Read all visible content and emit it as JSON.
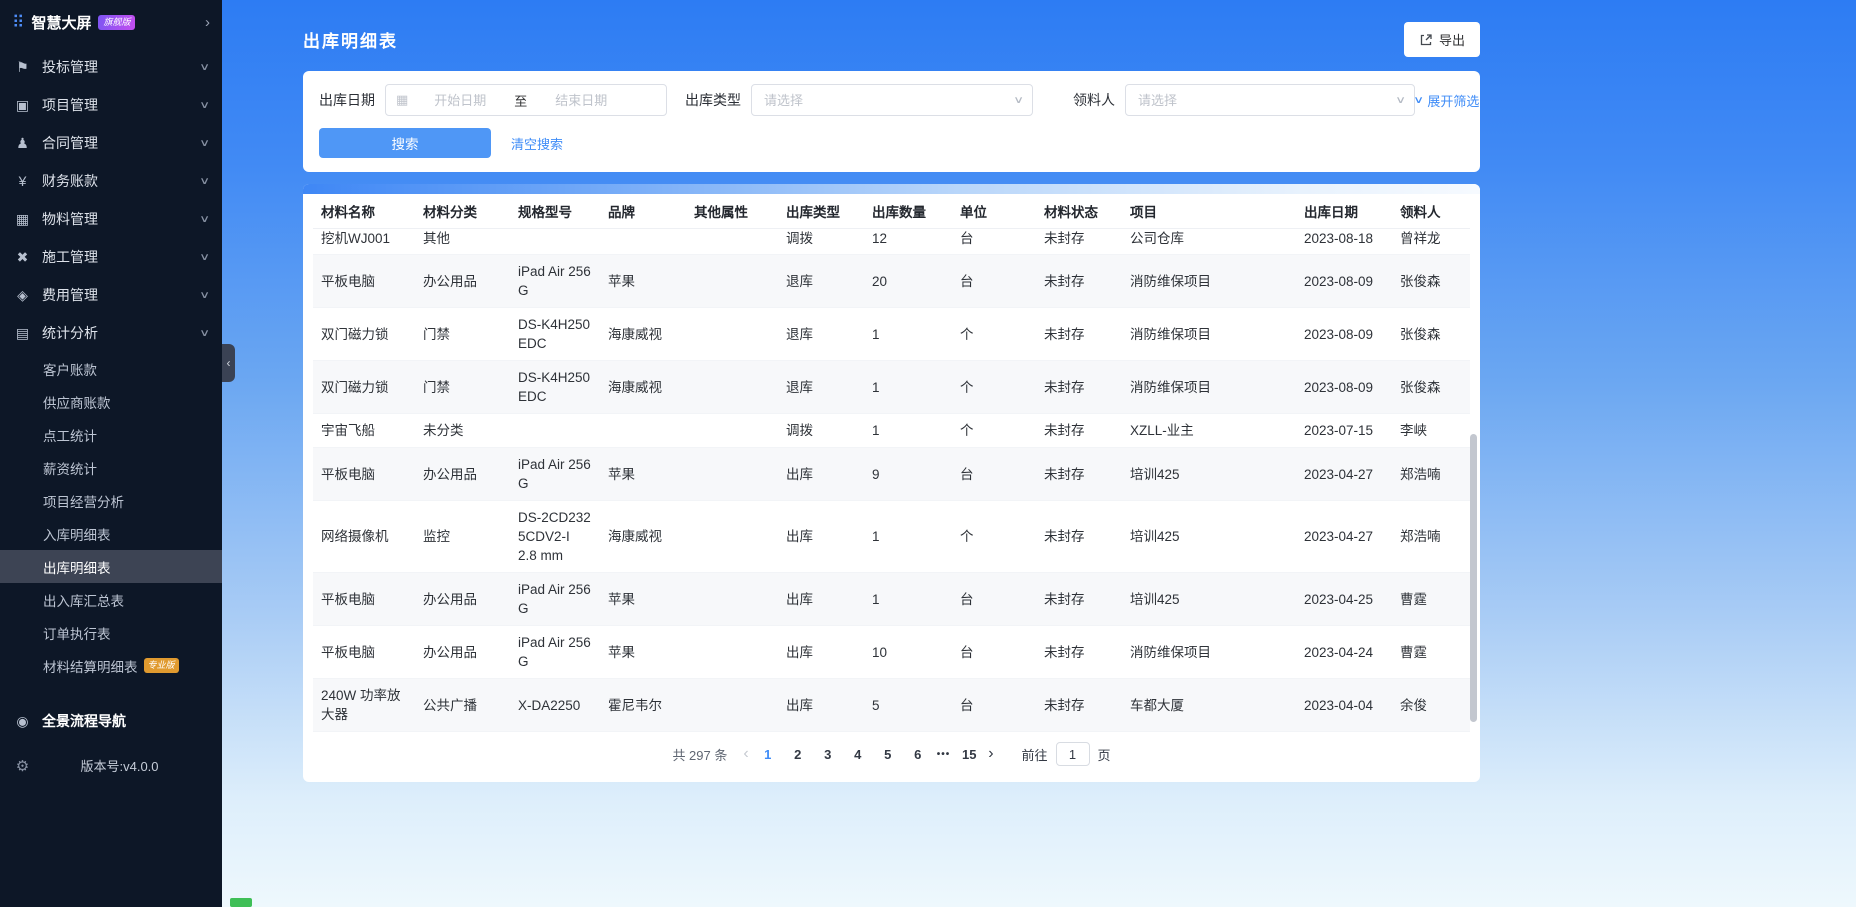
{
  "colors": {
    "accent": "#409eff",
    "sidebar_bg": "#0d1727",
    "gradient_top": "#2d7cf3",
    "gradient_bottom": "#eef8fd",
    "edition_badge": "#a452f1",
    "pro_badge": "#e09a2f",
    "search_button": "#4f97f6"
  },
  "sidebar": {
    "logo": {
      "title": "智慧大屏",
      "badge": "旗舰版"
    },
    "items": [
      {
        "label": "投标管理",
        "icon": "bid"
      },
      {
        "label": "项目管理",
        "icon": "project"
      },
      {
        "label": "合同管理",
        "icon": "contract"
      },
      {
        "label": "财务账款",
        "icon": "finance"
      },
      {
        "label": "物料管理",
        "icon": "material"
      },
      {
        "label": "施工管理",
        "icon": "construction"
      },
      {
        "label": "费用管理",
        "icon": "expense"
      },
      {
        "label": "统计分析",
        "icon": "stats",
        "expanded": true
      }
    ],
    "submenu": [
      {
        "label": "客户账款"
      },
      {
        "label": "供应商账款"
      },
      {
        "label": "点工统计"
      },
      {
        "label": "薪资统计"
      },
      {
        "label": "项目经营分析"
      },
      {
        "label": "入库明细表"
      },
      {
        "label": "出库明细表",
        "active": true
      },
      {
        "label": "出入库汇总表"
      },
      {
        "label": "订单执行表"
      },
      {
        "label": "材料结算明细表",
        "badge": "专业版"
      }
    ],
    "footer_item": "全景流程导航",
    "version": "版本号:v4.0.0"
  },
  "header": {
    "title": "出库明细表",
    "export_label": "导出"
  },
  "filters": {
    "date_label": "出库日期",
    "date_start_placeholder": "开始日期",
    "date_to": "至",
    "date_end_placeholder": "结束日期",
    "type_label": "出库类型",
    "type_placeholder": "请选择",
    "receiver_label": "领料人",
    "receiver_placeholder": "请选择",
    "expand_label": "展开筛选",
    "search_label": "搜索",
    "clear_label": "清空搜索"
  },
  "table": {
    "columns": [
      "材料名称",
      "材料分类",
      "规格型号",
      "品牌",
      "其他属性",
      "出库类型",
      "出库数量",
      "单位",
      "材料状态",
      "项目",
      "出库日期",
      "领料人"
    ],
    "rows": [
      [
        "挖机WJ001",
        "其他",
        "",
        "",
        "",
        "调拨",
        "12",
        "台",
        "未封存",
        "公司仓库",
        "2023-08-18",
        "曾祥龙"
      ],
      [
        "平板电脑",
        "办公用品",
        "iPad Air 256 G",
        "苹果",
        "",
        "退库",
        "20",
        "台",
        "未封存",
        "消防维保项目",
        "2023-08-09",
        "张俊森"
      ],
      [
        "双门磁力锁",
        "门禁",
        "DS-K4H250 EDC",
        "海康威视",
        "",
        "退库",
        "1",
        "个",
        "未封存",
        "消防维保项目",
        "2023-08-09",
        "张俊森"
      ],
      [
        "双门磁力锁",
        "门禁",
        "DS-K4H250 EDC",
        "海康威视",
        "",
        "退库",
        "1",
        "个",
        "未封存",
        "消防维保项目",
        "2023-08-09",
        "张俊森"
      ],
      [
        "宇宙飞船",
        "未分类",
        "",
        "",
        "",
        "调拨",
        "1",
        "个",
        "未封存",
        "XZLL-业主",
        "2023-07-15",
        "李峡"
      ],
      [
        "平板电脑",
        "办公用品",
        "iPad Air 256 G",
        "苹果",
        "",
        "出库",
        "9",
        "台",
        "未封存",
        "培训425",
        "2023-04-27",
        "郑浩喃"
      ],
      [
        "网络摄像机",
        "监控",
        "DS-2CD232 5CDV2-I 2.8 mm",
        "海康威视",
        "",
        "出库",
        "1",
        "个",
        "未封存",
        "培训425",
        "2023-04-27",
        "郑浩喃"
      ],
      [
        "平板电脑",
        "办公用品",
        "iPad Air 256 G",
        "苹果",
        "",
        "出库",
        "1",
        "台",
        "未封存",
        "培训425",
        "2023-04-25",
        "曹霆"
      ],
      [
        "平板电脑",
        "办公用品",
        "iPad Air 256 G",
        "苹果",
        "",
        "出库",
        "10",
        "台",
        "未封存",
        "消防维保项目",
        "2023-04-24",
        "曹霆"
      ],
      [
        "240W 功率放大器",
        "公共广播",
        "X-DA2250",
        "霍尼韦尔",
        "",
        "出库",
        "5",
        "台",
        "未封存",
        "车都大厦",
        "2023-04-04",
        "余俊"
      ]
    ]
  },
  "pagination": {
    "total": "共 297 条",
    "pages": [
      "1",
      "2",
      "3",
      "4",
      "5",
      "6"
    ],
    "ellipsis": "•••",
    "last_page": "15",
    "current": "1",
    "goto_label": "前往",
    "goto_value": "1",
    "page_suffix": "页"
  }
}
